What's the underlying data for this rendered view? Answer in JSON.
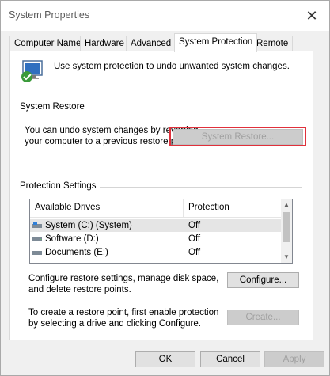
{
  "window": {
    "title": "System Properties"
  },
  "tabs": [
    "Computer Name",
    "Hardware",
    "Advanced",
    "System Protection",
    "Remote"
  ],
  "active_tab": "System Protection",
  "intro_text": "Use system protection to undo unwanted system changes.",
  "system_restore": {
    "group_label": "System Restore",
    "description_line1": "You can undo system changes by reverting",
    "description_line2": "your computer to a previous restore point.",
    "button_label": "System Restore..."
  },
  "protection_settings": {
    "group_label": "Protection Settings",
    "columns": [
      "Available Drives",
      "Protection"
    ],
    "drives": [
      {
        "name": "System (C:) (System)",
        "protection": "Off",
        "icon": "system-drive-icon"
      },
      {
        "name": "Software (D:)",
        "protection": "Off",
        "icon": "drive-icon"
      },
      {
        "name": "Documents (E:)",
        "protection": "Off",
        "icon": "drive-icon"
      }
    ],
    "configure_text_line1": "Configure restore settings, manage disk space,",
    "configure_text_line2": "and delete restore points.",
    "configure_button": "Configure...",
    "create_text_line1": "To create a restore point, first enable protection",
    "create_text_line2": "by selecting a drive and clicking Configure.",
    "create_button": "Create..."
  },
  "footer": {
    "ok": "OK",
    "cancel": "Cancel",
    "apply": "Apply"
  },
  "colors": {
    "highlight": "#e0303b",
    "disabled_text": "#a0a0a0"
  }
}
